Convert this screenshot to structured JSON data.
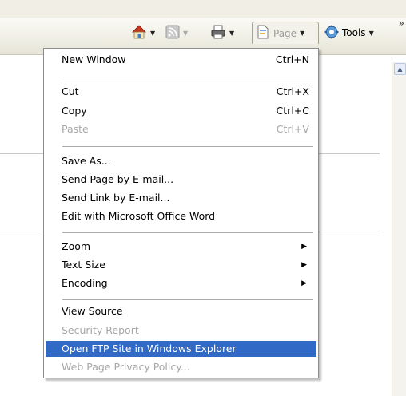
{
  "toolbar": {
    "page_label": "Page",
    "tools_label": "Tools",
    "overflow": "»"
  },
  "menu": {
    "items": [
      {
        "label": "New Window",
        "shortcut": "Ctrl+N",
        "disabled": false
      },
      {
        "label": "Cut",
        "shortcut": "Ctrl+X",
        "disabled": false
      },
      {
        "label": "Copy",
        "shortcut": "Ctrl+C",
        "disabled": false
      },
      {
        "label": "Paste",
        "shortcut": "Ctrl+V",
        "disabled": true
      },
      {
        "label": "Save As...",
        "shortcut": "",
        "disabled": false
      },
      {
        "label": "Send Page by E-mail...",
        "shortcut": "",
        "disabled": false
      },
      {
        "label": "Send Link by E-mail...",
        "shortcut": "",
        "disabled": false
      },
      {
        "label": "Edit with Microsoft Office Word",
        "shortcut": "",
        "disabled": false
      },
      {
        "label": "Zoom",
        "shortcut": "",
        "disabled": false,
        "submenu": true
      },
      {
        "label": "Text Size",
        "shortcut": "",
        "disabled": false,
        "submenu": true
      },
      {
        "label": "Encoding",
        "shortcut": "",
        "disabled": false,
        "submenu": true
      },
      {
        "label": "View Source",
        "shortcut": "",
        "disabled": false
      },
      {
        "label": "Security Report",
        "shortcut": "",
        "disabled": true
      },
      {
        "label": "Open FTP Site in Windows Explorer",
        "shortcut": "",
        "disabled": false,
        "highlighted": true
      },
      {
        "label": "Web Page Privacy Policy...",
        "shortcut": "",
        "disabled": true
      }
    ]
  },
  "colors": {
    "highlight": "#3169c6",
    "disabled_text": "#a7a7a7"
  },
  "icons": [
    "home-icon",
    "feeds-icon",
    "print-icon",
    "page-icon",
    "tools-gear-icon",
    "submenu-arrow-icon"
  ]
}
